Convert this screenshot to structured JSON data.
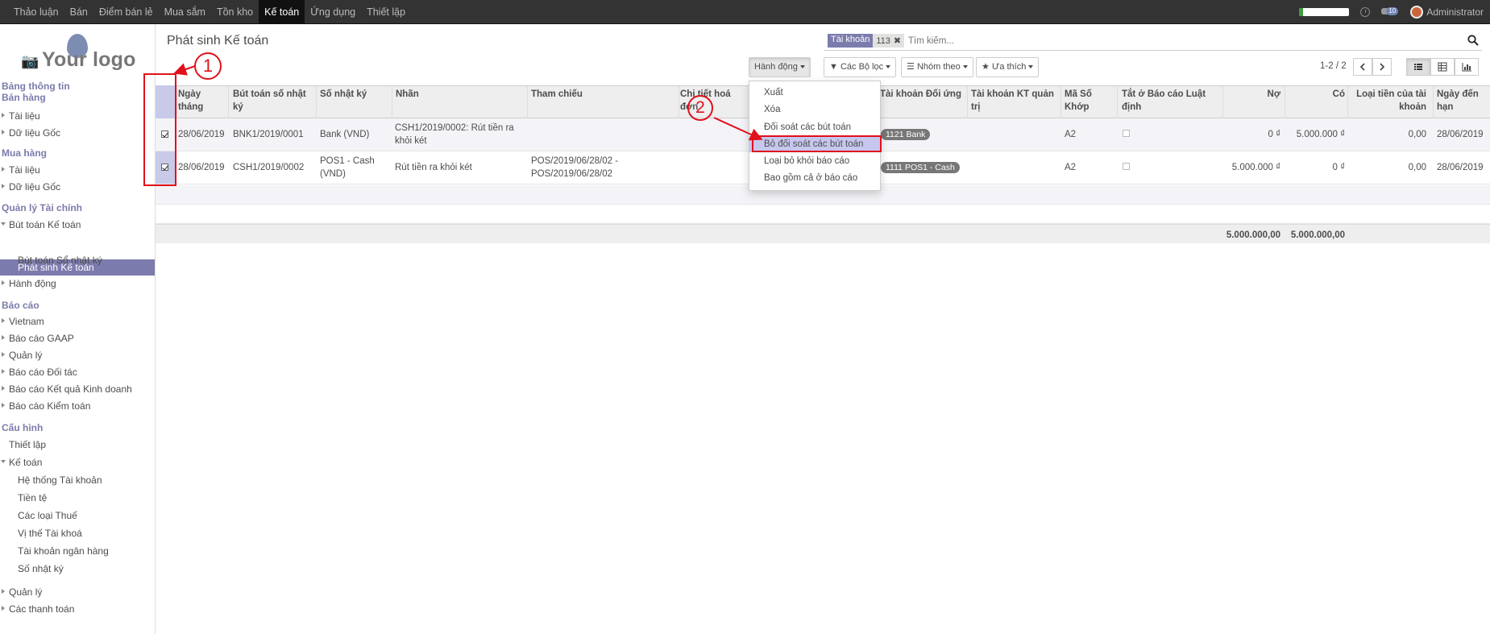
{
  "topbar": {
    "menu": [
      "Thảo luận",
      "Bán",
      "Điểm bán lẻ",
      "Mua sắm",
      "Tồn kho",
      "Kế toán",
      "Ứng dụng",
      "Thiết lập"
    ],
    "active_index": 5,
    "progress": 0.08,
    "chat_count": "10",
    "user": "Administrator"
  },
  "sidebar": {
    "logo_text": "Your logo",
    "sections": [
      {
        "heading": "Bảng thông tin"
      },
      {
        "heading": "Bán hàng",
        "items": [
          "Tài liệu",
          "Dữ liệu Gốc"
        ]
      },
      {
        "heading": "Mua hàng",
        "items": [
          "Tài liệu",
          "Dữ liệu Gốc"
        ]
      },
      {
        "heading": "Quản lý Tài chính",
        "items": [
          "Bút toán Kế toán"
        ],
        "subitems": [
          "Phát sinh Kế toán",
          "Bút toán Sổ nhật ký"
        ],
        "after": [
          "Hành động"
        ]
      },
      {
        "heading": "Báo cáo",
        "items": [
          "Vietnam",
          "Báo cáo GAAP",
          "Quản lý",
          "Báo cáo Đối tác",
          "Báo cáo Kết quả Kinh doanh",
          "Báo cáo Kiểm toán"
        ]
      },
      {
        "heading": "Cấu hình",
        "items": [
          "Thiết lập",
          "Kế toán"
        ],
        "subitems": [
          "Hệ thống Tài khoản",
          "Tiền tệ",
          "Các loại Thuế",
          "Vị thế Tài khoá",
          "Tài khoản ngân hàng",
          "Số nhật ký"
        ],
        "after": [
          "Quản lý",
          "Các thanh toán"
        ]
      }
    ]
  },
  "page": {
    "title": "Phát sinh Kế toán"
  },
  "search": {
    "facet_key": "Tài khoản",
    "facet_value": "113",
    "placeholder": "Tìm kiếm..."
  },
  "toolbar": {
    "action_label": "Hành động",
    "filters_label": "Các Bộ lọc",
    "groupby_label": "Nhóm theo",
    "favorites_label": "Ưa thích",
    "pager": "1-2 / 2"
  },
  "table": {
    "headers": [
      "Ngày tháng",
      "Bút toán số nhật ký",
      "Số nhật ký",
      "Nhãn",
      "Tham chiếu",
      "Chi tiết hoá đơn",
      "Tài khoản Đối ứng",
      "Tài khoản KT quản trị",
      "Mã Số Khớp",
      "Tắt ở Báo cáo Luật định",
      "Nợ",
      "Có",
      "Loại tiền của tài khoản",
      "Ngày đến hạn"
    ],
    "rows": [
      {
        "date": "28/06/2019",
        "move": "BNK1/2019/0001",
        "journal": "Bank (VND)",
        "label": "CSH1/2019/0002: Rút tiền ra khỏi két",
        "ref": "",
        "counterpart": "1121 Bank",
        "match": "A2",
        "debit": "0 ₫",
        "credit": "5.000.000 ₫",
        "amount_currency": "0,00",
        "due": "28/06/2019"
      },
      {
        "date": "28/06/2019",
        "move": "CSH1/2019/0002",
        "journal": "POS1 - Cash (VND)",
        "label": "Rút tiền ra khỏi két",
        "ref": "POS/2019/06/28/02 - POS/2019/06/28/02",
        "counterpart": "1111 POS1 - Cash",
        "match": "A2",
        "debit": "5.000.000 ₫",
        "credit": "0 ₫",
        "amount_currency": "0,00",
        "due": "28/06/2019"
      }
    ],
    "totals": {
      "debit": "5.000.000,00",
      "credit": "5.000.000,00"
    }
  },
  "action_menu": {
    "items": [
      "Xuất",
      "Xóa",
      "Đối soát các bút toán",
      "Bỏ đối soát các bút toán",
      "Loại bỏ khỏi báo cáo",
      "Bao gồm cả ở báo cáo"
    ],
    "highlighted_index": 3
  },
  "annotations": {
    "step1": "1",
    "step2": "2",
    "color": "#e0111b"
  },
  "colors": {
    "brand": "#7c7bad",
    "topbar": "#333333",
    "highlight": "#c7c7ee"
  }
}
